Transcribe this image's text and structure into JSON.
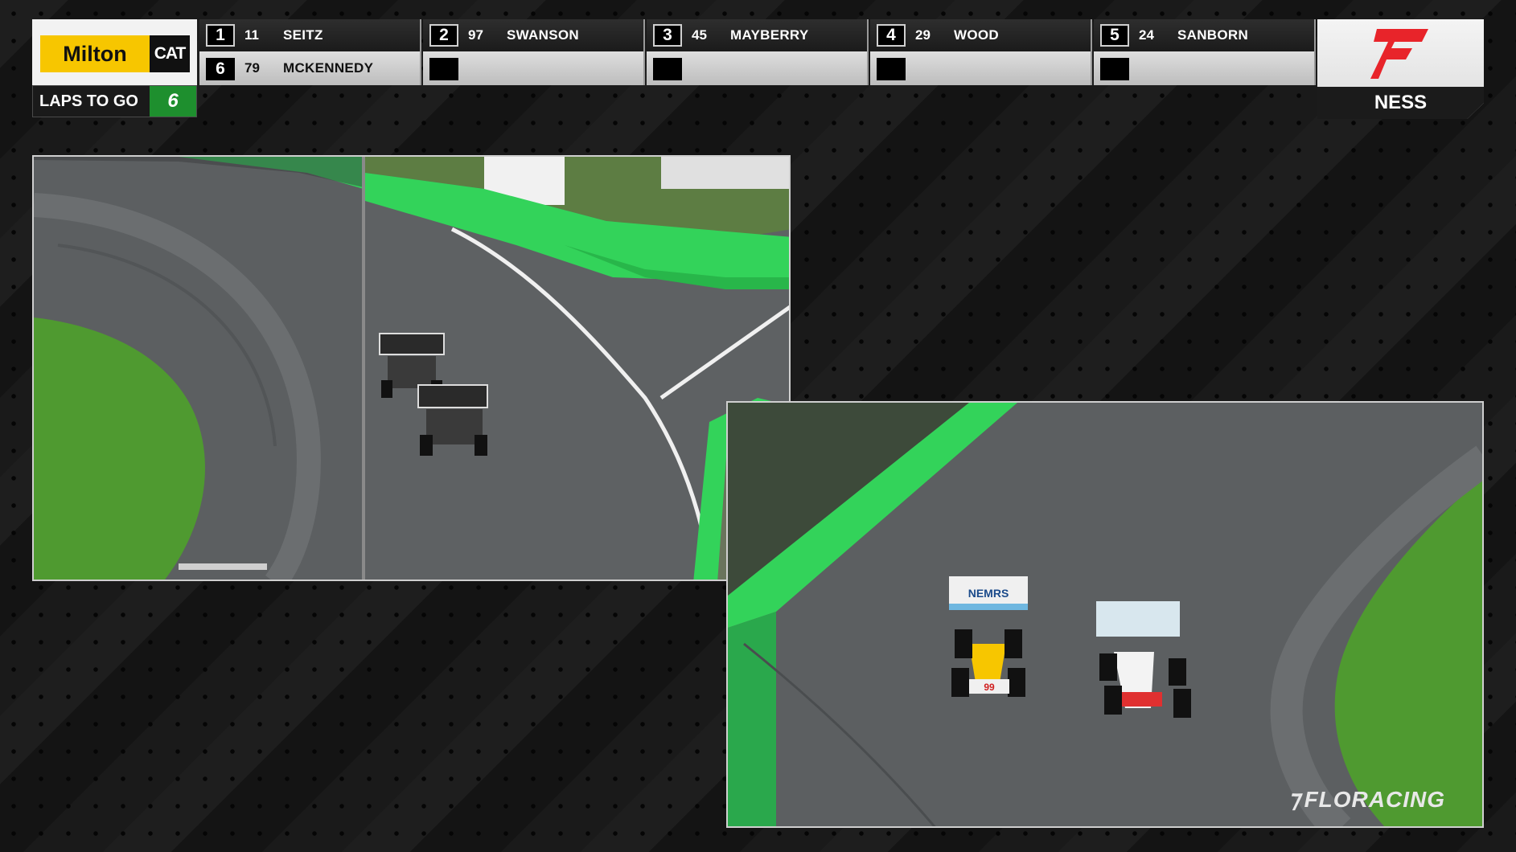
{
  "sponsor": {
    "name": "Milton",
    "brand": "CAT"
  },
  "laps": {
    "label": "LAPS TO GO",
    "value": "6"
  },
  "leaderboard": [
    {
      "pos": "1",
      "car": "11",
      "driver": "SEITZ"
    },
    {
      "pos": "2",
      "car": "97",
      "driver": "SWANSON"
    },
    {
      "pos": "3",
      "car": "45",
      "driver": "MAYBERRY"
    },
    {
      "pos": "4",
      "car": "29",
      "driver": "WOOD"
    },
    {
      "pos": "5",
      "car": "24",
      "driver": "SANBORN"
    },
    {
      "pos": "6",
      "car": "79",
      "driver": "MCKENNEDY"
    },
    {
      "pos": "",
      "car": "",
      "driver": ""
    },
    {
      "pos": "",
      "car": "",
      "driver": ""
    },
    {
      "pos": "",
      "car": "",
      "driver": ""
    },
    {
      "pos": "",
      "car": "",
      "driver": ""
    }
  ],
  "brand": {
    "series": "NESS",
    "logo_icon": "flosports-f-icon",
    "logo_color": "#e8242a"
  },
  "feeds": {
    "left": {
      "icon": "camera-feed-split-view"
    },
    "right": {
      "icon": "camera-feed-wide-view",
      "watermark": "FLORACING",
      "car_wing_text": "NEMRS",
      "car_number": "99"
    }
  },
  "colors": {
    "wall_green": "#33d35a",
    "grass": "#4f9a30",
    "track": "#5c5f61",
    "accent_yellow": "#f7c600",
    "laps_green": "#1e8f2e"
  }
}
